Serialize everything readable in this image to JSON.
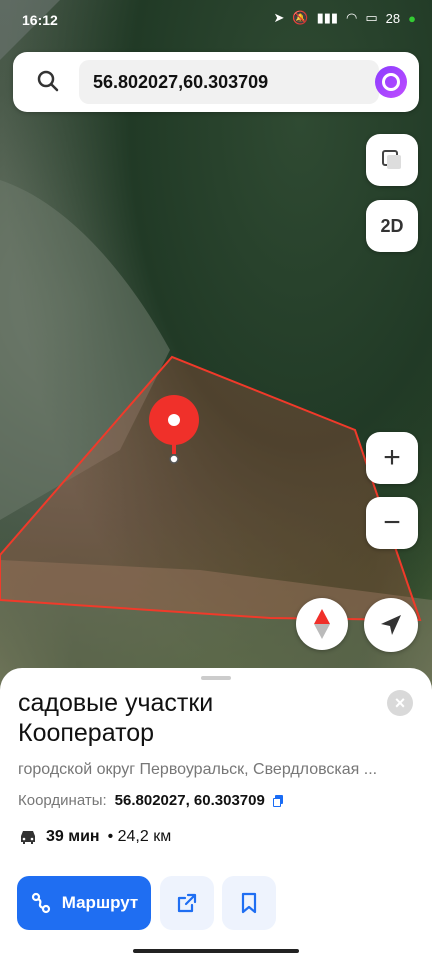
{
  "status_bar": {
    "time": "16:12",
    "battery": "28"
  },
  "search": {
    "query": "56.802027,60.303709"
  },
  "map_controls": {
    "mode_label": "2D",
    "zoom_in": "+",
    "zoom_out": "−"
  },
  "place": {
    "title_line1": "садовые участки",
    "title_line2": "Кооператор",
    "address": "городской округ Первоуральск, Свердловская ...",
    "coords_label": "Координаты:",
    "coords_value": "56.802027, 60.303709",
    "travel_time": "39 мин",
    "travel_distance": "• 24,2 км",
    "route_label": "Маршрут",
    "close": "×"
  },
  "colors": {
    "accent_blue": "#1f6ef2",
    "pin_red": "#f0302a",
    "area_outline": "#f03a2a",
    "alice_purple": "#9b3cff"
  }
}
